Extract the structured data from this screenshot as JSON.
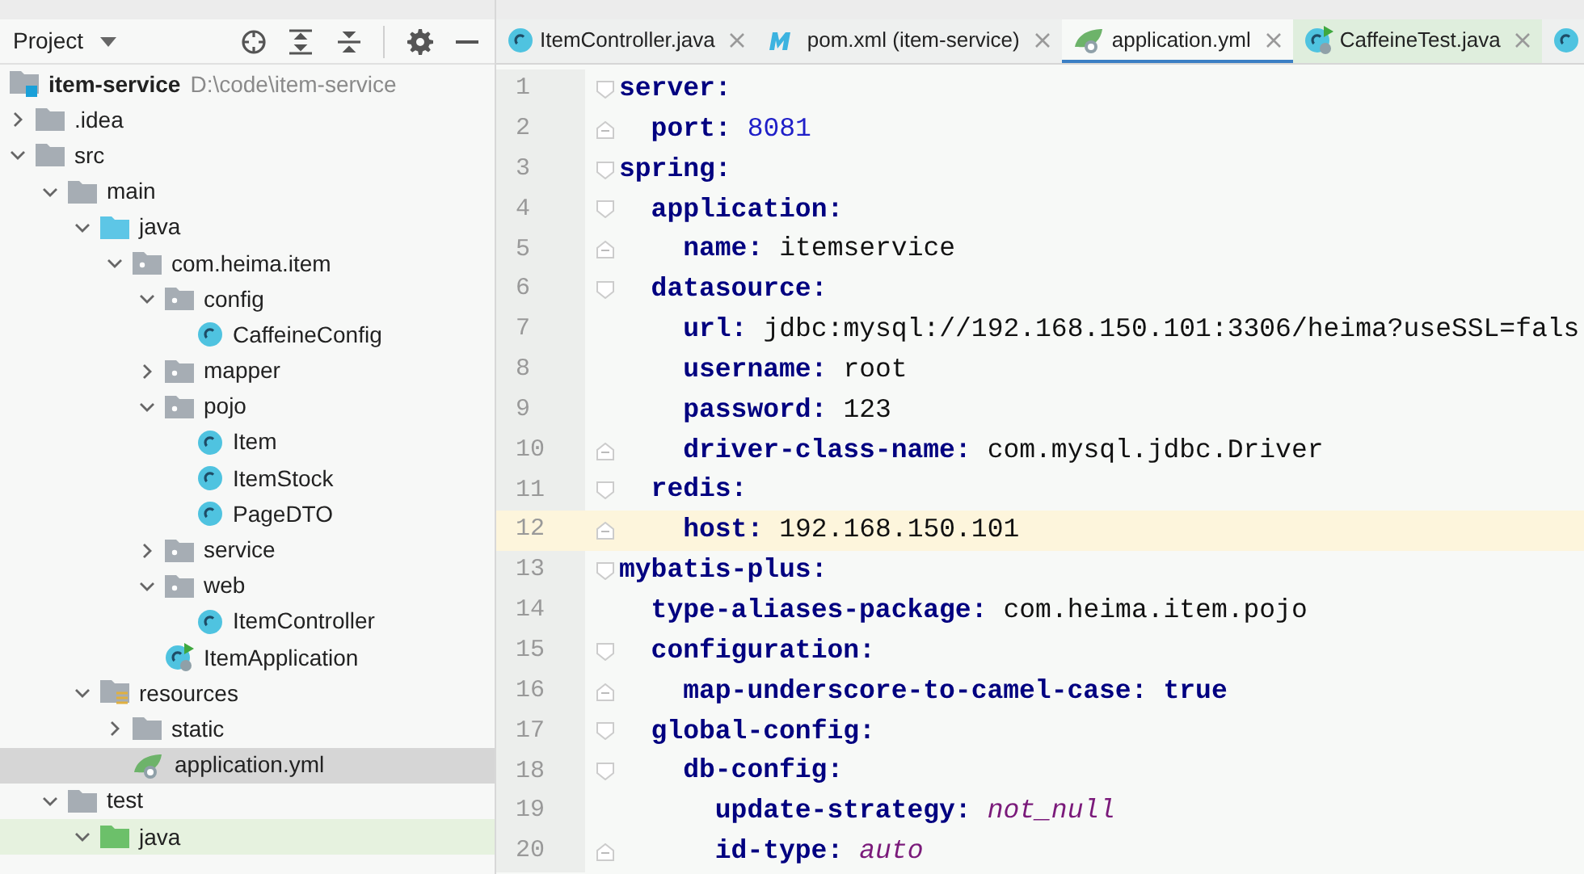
{
  "project_panel": {
    "title": "Project",
    "tree": [
      {
        "label": "item-service",
        "path": "D:\\code\\item-service",
        "kind": "module",
        "selected": false,
        "children": [
          {
            "label": ".idea",
            "kind": "folder",
            "expanded": false,
            "selected": false
          },
          {
            "label": "src",
            "kind": "folder",
            "expanded": true,
            "selected": false,
            "children": [
              {
                "label": "main",
                "kind": "folder",
                "expanded": true,
                "selected": false,
                "children": [
                  {
                    "label": "java",
                    "kind": "source",
                    "expanded": true,
                    "selected": false,
                    "children": [
                      {
                        "label": "com.heima.item",
                        "kind": "package",
                        "expanded": true,
                        "selected": false,
                        "children": [
                          {
                            "label": "config",
                            "kind": "package",
                            "expanded": true,
                            "selected": false,
                            "children": [
                              {
                                "label": "CaffeineConfig",
                                "kind": "class",
                                "selected": false
                              }
                            ]
                          },
                          {
                            "label": "mapper",
                            "kind": "package",
                            "expanded": false,
                            "selected": false
                          },
                          {
                            "label": "pojo",
                            "kind": "package",
                            "expanded": true,
                            "selected": false,
                            "children": [
                              {
                                "label": "Item",
                                "kind": "class",
                                "selected": false
                              },
                              {
                                "label": "ItemStock",
                                "kind": "class",
                                "selected": false
                              },
                              {
                                "label": "PageDTO",
                                "kind": "class",
                                "selected": false
                              }
                            ]
                          },
                          {
                            "label": "service",
                            "kind": "package",
                            "expanded": false,
                            "selected": false
                          },
                          {
                            "label": "web",
                            "kind": "package",
                            "expanded": true,
                            "selected": false,
                            "children": [
                              {
                                "label": "ItemController",
                                "kind": "class",
                                "selected": false
                              }
                            ]
                          },
                          {
                            "label": "ItemApplication",
                            "kind": "app",
                            "selected": false
                          }
                        ]
                      }
                    ]
                  },
                  {
                    "label": "resources",
                    "kind": "resources",
                    "expanded": true,
                    "selected": false,
                    "children": [
                      {
                        "label": "static",
                        "kind": "folder",
                        "expanded": false,
                        "selected": false
                      },
                      {
                        "label": "application.yml",
                        "kind": "yml",
                        "selected": true
                      }
                    ]
                  }
                ]
              },
              {
                "label": "test",
                "kind": "folder",
                "expanded": true,
                "selected": false,
                "children": [
                  {
                    "label": "java",
                    "kind": "test",
                    "expanded": true,
                    "selected": false
                  }
                ]
              }
            ]
          }
        ]
      }
    ]
  },
  "tabs": [
    {
      "label": "ItemController.java",
      "kind": "class",
      "selected": false
    },
    {
      "label": "pom.xml (item-service)",
      "kind": "maven",
      "selected": false
    },
    {
      "label": "application.yml",
      "kind": "yml",
      "selected": true
    },
    {
      "label": "CaffeineTest.java",
      "kind": "test",
      "selected": false
    },
    {
      "kind": "class",
      "selected": false
    }
  ],
  "editor": {
    "lines": [
      {
        "number": "1",
        "key": "server:",
        "kind": "opener",
        "current": false,
        "children": [
          {
            "number": "2",
            "key": "port:",
            "value": {
              "text": "8081",
              "kind": "number"
            },
            "kind": "closer",
            "current": false
          }
        ]
      },
      {
        "number": "3",
        "key": "spring:",
        "kind": "opener",
        "current": false,
        "children": [
          {
            "number": "4",
            "key": "application:",
            "kind": "opener",
            "current": false,
            "children": [
              {
                "number": "5",
                "key": "name:",
                "value": {
                  "text": "itemservice",
                  "kind": "plain"
                },
                "kind": "closer",
                "current": false
              }
            ]
          },
          {
            "number": "6",
            "key": "datasource:",
            "kind": "opener",
            "current": false,
            "children": [
              {
                "number": "7",
                "key": "url:",
                "value": {
                  "text": "jdbc:mysql://192.168.150.101:3306/heima?useSSL=fals",
                  "kind": "plain"
                },
                "kind": "inner",
                "current": false
              },
              {
                "number": "8",
                "key": "username:",
                "value": {
                  "text": "root",
                  "kind": "plain"
                },
                "kind": "inner",
                "current": false
              },
              {
                "number": "9",
                "key": "password:",
                "value": {
                  "text": "123",
                  "kind": "plain"
                },
                "kind": "inner",
                "current": false
              },
              {
                "number": "10",
                "key": "driver-class-name:",
                "value": {
                  "text": "com.mysql.jdbc.Driver",
                  "kind": "plain"
                },
                "kind": "closer",
                "current": false
              }
            ]
          },
          {
            "number": "11",
            "key": "redis:",
            "kind": "opener",
            "current": false,
            "children": [
              {
                "number": "12",
                "key": "host:",
                "value": {
                  "text": "192.168.150.101",
                  "kind": "plain"
                },
                "kind": "closer",
                "current": true
              }
            ]
          }
        ]
      },
      {
        "number": "13",
        "key": "mybatis-plus:",
        "kind": "opener",
        "current": false,
        "children": [
          {
            "number": "14",
            "key": "type-aliases-package:",
            "value": {
              "text": "com.heima.item.pojo",
              "kind": "plain"
            },
            "kind": "inner",
            "current": false
          },
          {
            "number": "15",
            "key": "configuration:",
            "kind": "opener",
            "current": false,
            "children": [
              {
                "number": "16",
                "key": "map-underscore-to-camel-case:",
                "value": {
                  "text": "true",
                  "kind": "bool"
                },
                "kind": "closer",
                "current": false
              }
            ]
          },
          {
            "number": "17",
            "key": "global-config:",
            "kind": "opener",
            "current": false,
            "children": [
              {
                "number": "18",
                "key": "db-config:",
                "kind": "opener",
                "current": false,
                "children": [
                  {
                    "number": "19",
                    "key": "update-strategy:",
                    "value": {
                      "text": "not_null",
                      "kind": "constant"
                    },
                    "kind": "inner",
                    "current": false
                  },
                  {
                    "number": "20",
                    "key": "id-type:",
                    "value": {
                      "text": "auto",
                      "kind": "constant"
                    },
                    "kind": "closer",
                    "current": false
                  }
                ]
              }
            ]
          }
        ]
      }
    ]
  }
}
